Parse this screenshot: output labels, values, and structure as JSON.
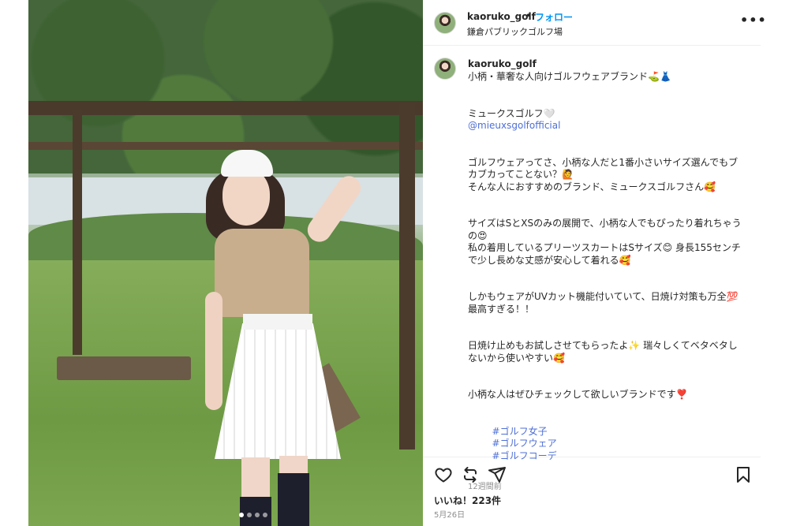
{
  "post": {
    "username": "kaoruko_golf",
    "separator": "•",
    "follow_label": "フォロー",
    "location": "鎌倉パブリックゴルフ場",
    "more_icon": "more-horizontal-icon",
    "next_icon": "chevron-right-icon",
    "carousel": {
      "count": 4,
      "active_index": 0
    }
  },
  "caption": {
    "username": "kaoruko_golf",
    "line1": "小柄・華奢な人向けゴルフウェアブランド⛳👗",
    "brand": "ミュークスゴルフ🤍",
    "mention": "@mieuxsgolfofficial",
    "para1_l1": "ゴルフウェアってさ、小柄な人だと1番小さいサイズ選んでもブ",
    "para1_l2": "カブカってことない？🙋",
    "para1_l3": "そんな人におすすめのブランド、ミュークスゴルフさん🥰",
    "para2_l1": "サイズはSとXSのみの展開で、小柄な人でもぴったり着れちゃう",
    "para2_l2": "の😍",
    "para2_l3": "私の着用しているプリーツスカートはSサイズ😊 身長155センチ",
    "para2_l4": "で少し長めな丈感が安心して着れる🥰",
    "para3_l1": "しかもウェアがUVカット機能付いていて、日焼け対策も万全💯",
    "para3_l2": "最高すぎる！！",
    "para4_l1": "日焼け止めもお試しさせてもらったよ✨ 瑞々しくてベタベタし",
    "para4_l2": "ないから使いやすい🥰",
    "para5_l1": "小柄な人はぜひチェックして欲しいブランドです❣️",
    "hashtags": [
      "#ゴルフ女子",
      "#ゴルフウェア",
      "#ゴルフコーデ"
    ],
    "time_ago": "12週間前"
  },
  "actions": {
    "like_icon": "heart-icon",
    "repost_icon": "repost-icon",
    "share_icon": "send-icon",
    "save_icon": "bookmark-icon",
    "likes_text": "いいね！223件",
    "date": "5月26日"
  }
}
